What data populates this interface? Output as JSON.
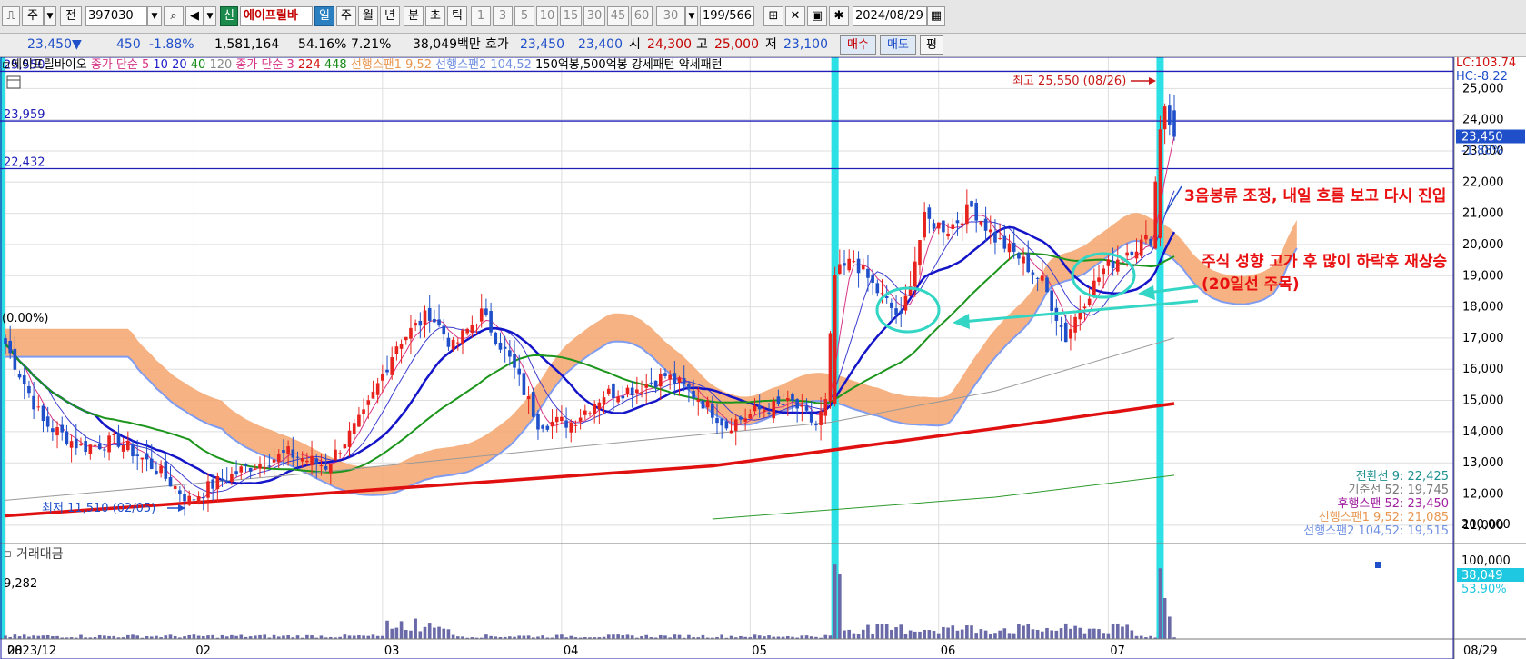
{
  "toolbar": {
    "period_label": "주",
    "prev_label": "전",
    "code": "397030",
    "new_badge": "신",
    "stock_name": "에이프릴바",
    "periods": [
      "일",
      "주",
      "월",
      "년",
      "분",
      "초",
      "틱"
    ],
    "selected_period": "일",
    "intervals": [
      "1",
      "3",
      "5",
      "10",
      "15",
      "30",
      "45",
      "60"
    ],
    "custom_interval": "30",
    "count": "199/566",
    "date": "2024/08/29"
  },
  "quote": {
    "price": "23,450",
    "arrow": "▼",
    "change": "450",
    "change_rate": "-1.88%",
    "volume": "1,581,164",
    "volume_ratio": "54.16%",
    "turnover_rate": "7.21%",
    "amount": "38,049백만",
    "hoga_label": "호가",
    "ask": "23,450",
    "bid": "23,400",
    "open_label": "시",
    "open": "24,300",
    "high_label": "고",
    "high": "25,000",
    "low_label": "저",
    "low": "23,100",
    "buy_label": "매수",
    "sell_label": "매도",
    "avg_label": "평"
  },
  "legend": [
    {
      "text": "에이프릴바이오",
      "color": "#000000"
    },
    {
      "text": "종가 단순 5",
      "color": "#d63384"
    },
    {
      "text": "10",
      "color": "#2020c8"
    },
    {
      "text": "20",
      "color": "#2020c8"
    },
    {
      "text": "40",
      "color": "#138a13"
    },
    {
      "text": "120",
      "color": "#888888"
    },
    {
      "text": "종가 단순 3",
      "color": "#d63384"
    },
    {
      "text": "224",
      "color": "#d01010"
    },
    {
      "text": "448",
      "color": "#138a13"
    },
    {
      "text": "선행스팬1 9,52",
      "color": "#e89650"
    },
    {
      "text": "선행스팬2 104,52",
      "color": "#6f8fe0"
    },
    {
      "text": "150억봉,500억봉 강세패턴",
      "color": "#000000"
    },
    {
      "text": "약세패턴",
      "color": "#000000"
    }
  ],
  "colors": {
    "up": "#e8231e",
    "down": "#1f4fc9",
    "highlight": "#2de0e6",
    "cloud_bull": "#f4a46c",
    "cloud_bear": "#7f9cf0",
    "ma224": "#e01010",
    "ma20": "#1414c8",
    "ma40": "#1b951b",
    "annotation": "#e81010",
    "arrow_cyan": "#33d6c4"
  },
  "hlines": [
    {
      "label": "25,550",
      "value": 25550
    },
    {
      "label": "23,959",
      "value": 23959
    },
    {
      "label": "22,432",
      "value": 22432
    }
  ],
  "right_top": {
    "lc": "LC:103.74",
    "hc": "HC:-8.22"
  },
  "price_tag": {
    "value": "23,450",
    "rate": "-1.88%"
  },
  "max_label": "최고 25,550 (08/26)",
  "min_label": "최저 11,510 (02/05)",
  "zero_label": "(0.00%)",
  "annotations": {
    "line1": "3음봉류 조정, 내일 흐름 보고 다시 진입",
    "line2": "주식 성향 고가 후 많이 하락후 재상승",
    "line3": "(20일선 주목)"
  },
  "ichimoku_labels": [
    {
      "text": "전환선 9: 22,425",
      "color": "#1d8f8f"
    },
    {
      "text": "기준선 52: 19,745",
      "color": "#777777"
    },
    {
      "text": "후행스팬 52: 23,450",
      "color": "#a020a0"
    },
    {
      "text": "선행스팬1 9,52: 21,085",
      "color": "#e89650"
    },
    {
      "text": "선행스팬2 104,52: 19,515",
      "color": "#6f8fe0"
    }
  ],
  "volume_panel": {
    "title": "거래대금",
    "left_value": "9,282",
    "right_labels": [
      "200,000",
      "100,000"
    ],
    "last_value": "38,049",
    "last_rate": "53.90%"
  },
  "chart_data": {
    "type": "candlestick",
    "ylim": [
      10500,
      26000
    ],
    "y_ticks": [
      11000,
      12000,
      13000,
      14000,
      15000,
      16000,
      17000,
      18000,
      19000,
      20000,
      21000,
      22000,
      23000,
      24000,
      25000
    ],
    "y_tick_labels": [
      "11,000",
      "12,000",
      "13,000",
      "14,000",
      "15,000",
      "16,000",
      "17,000",
      "18,000",
      "19,000",
      "20,000",
      "21,000",
      "22,000",
      "23,000",
      "24,000",
      "25,000"
    ],
    "x_labels": [
      "2023/12",
      "02",
      "03",
      "04",
      "05",
      "06",
      "07",
      "08"
    ],
    "last_date_label": "08/29",
    "highlight_events": [
      {
        "date": "06 (mid)"
      },
      {
        "date": "08/26"
      }
    ],
    "anchors": [
      {
        "d": 0,
        "c": 16800
      },
      {
        "d": 8,
        "c": 14300
      },
      {
        "d": 16,
        "c": 13500
      },
      {
        "d": 24,
        "c": 13700
      },
      {
        "d": 32,
        "c": 12800
      },
      {
        "d": 39,
        "c": 11800
      },
      {
        "d": 44,
        "c": 12300
      },
      {
        "d": 52,
        "c": 12900
      },
      {
        "d": 60,
        "c": 13300
      },
      {
        "d": 68,
        "c": 12900
      },
      {
        "d": 76,
        "c": 14500
      },
      {
        "d": 83,
        "c": 16800
      },
      {
        "d": 90,
        "c": 17800
      },
      {
        "d": 95,
        "c": 16700
      },
      {
        "d": 101,
        "c": 17800
      },
      {
        "d": 107,
        "c": 16300
      },
      {
        "d": 113,
        "c": 14300
      },
      {
        "d": 120,
        "c": 14300
      },
      {
        "d": 127,
        "c": 15200
      },
      {
        "d": 134,
        "c": 15400
      },
      {
        "d": 140,
        "c": 15800
      },
      {
        "d": 147,
        "c": 15100
      },
      {
        "d": 153,
        "c": 14200
      },
      {
        "d": 160,
        "c": 14700
      },
      {
        "d": 167,
        "c": 14900
      },
      {
        "d": 172,
        "c": 14200
      },
      {
        "d": 174,
        "c": 14900
      },
      {
        "d": 176,
        "c": 19000
      },
      {
        "d": 180,
        "c": 19500
      },
      {
        "d": 185,
        "c": 18500
      },
      {
        "d": 190,
        "c": 17600
      },
      {
        "d": 195,
        "c": 20800
      },
      {
        "d": 200,
        "c": 20500
      },
      {
        "d": 205,
        "c": 21200
      },
      {
        "d": 210,
        "c": 20200
      },
      {
        "d": 215,
        "c": 19600
      },
      {
        "d": 220,
        "c": 18800
      },
      {
        "d": 225,
        "c": 17000
      },
      {
        "d": 228,
        "c": 18000
      },
      {
        "d": 233,
        "c": 19200
      },
      {
        "d": 238,
        "c": 19800
      },
      {
        "d": 243,
        "c": 20200
      },
      {
        "d": 245,
        "c": 23800
      },
      {
        "d": 246,
        "c": 24500
      },
      {
        "d": 248,
        "c": 23450
      }
    ],
    "ma224": [
      {
        "d": 0,
        "v": 11300
      },
      {
        "d": 150,
        "v": 12900
      },
      {
        "d": 210,
        "v": 14100
      },
      {
        "d": 248,
        "v": 14900
      }
    ],
    "ma448": [
      {
        "d": 150,
        "v": 11200
      },
      {
        "d": 210,
        "v": 11900
      },
      {
        "d": 248,
        "v": 12600
      }
    ],
    "ma120": [
      {
        "d": 0,
        "v": 11800
      },
      {
        "d": 60,
        "v": 12600
      },
      {
        "d": 120,
        "v": 13500
      },
      {
        "d": 175,
        "v": 14300
      },
      {
        "d": 210,
        "v": 15300
      },
      {
        "d": 248,
        "v": 17000
      }
    ],
    "volume_spikes": [
      {
        "d": 176,
        "v": 200000
      },
      {
        "d": 177,
        "v": 175000
      },
      {
        "d": 245,
        "v": 190000
      },
      {
        "d": 246,
        "v": 110000
      },
      {
        "d": 247,
        "v": 60000
      }
    ]
  }
}
